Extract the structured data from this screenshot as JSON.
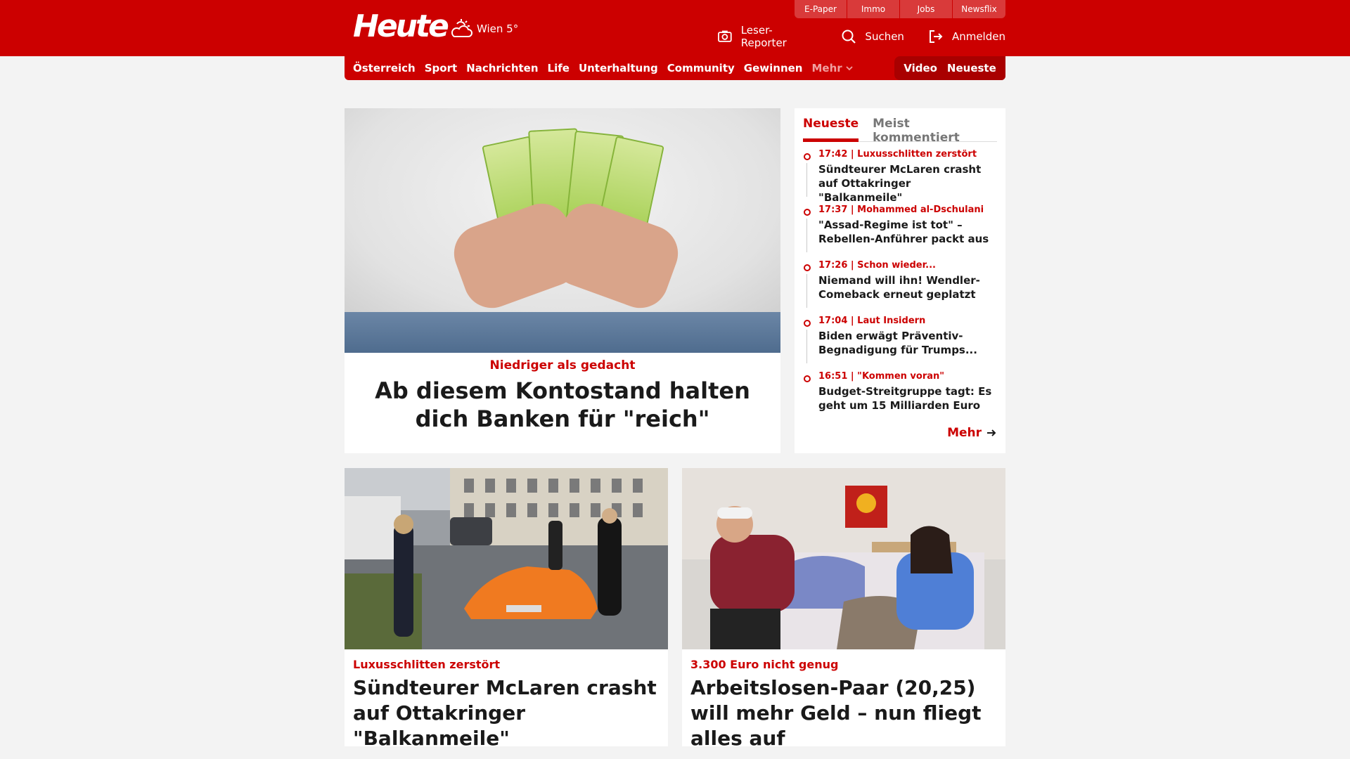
{
  "header": {
    "logo": "Heute",
    "weather": {
      "location": "Wien 5°",
      "icon": "partly-cloudy-icon"
    },
    "top_tabs": [
      "E-Paper",
      "Immo",
      "Jobs",
      "Newsflix"
    ],
    "actions": [
      {
        "label": "Leser-Reporter",
        "icon": "camera-icon"
      },
      {
        "label": "Suchen",
        "icon": "search-icon"
      },
      {
        "label": "Anmelden",
        "icon": "login-icon"
      }
    ]
  },
  "nav": {
    "items": [
      "Österreich",
      "Sport",
      "Nachrichten",
      "Life",
      "Unterhaltung",
      "Community",
      "Gewinnen"
    ],
    "more_label": "Mehr",
    "right_items": [
      "Video",
      "Neueste"
    ]
  },
  "hero": {
    "kicker": "Niedriger als gedacht",
    "title": "Ab diesem Kontostand halten dich Banken für \"reich\""
  },
  "side": {
    "tabs": [
      "Neueste",
      "Meist kommentiert"
    ],
    "items": [
      {
        "meta": "17:42 | Luxusschlitten zerstört",
        "title": "Sündteurer McLaren crasht auf Ottakringer \"Balkanmeile\""
      },
      {
        "meta": "17:37 | Mohammed al-Dschulani",
        "title": "\"Assad-Regime ist tot\" – Rebellen-Anführer packt aus"
      },
      {
        "meta": "17:26 | Schon wieder...",
        "title": "Niemand will ihn! Wendler-Comeback erneut geplatzt"
      },
      {
        "meta": "17:04 | Laut Insidern",
        "title": "Biden erwägt Präventiv-Begnadigung für Trumps..."
      },
      {
        "meta": "16:51 | \"Kommen voran\"",
        "title": "Budget-Streitgruppe tagt: Es geht um 15 Milliarden Euro"
      }
    ],
    "more_label": "Mehr"
  },
  "cards": [
    {
      "kicker": "Luxusschlitten zerstört",
      "title": "Sündteurer McLaren crasht auf Ottakringer \"Balkanmeile\""
    },
    {
      "kicker": "3.300 Euro nicht genug",
      "title": "Arbeitslosen-Paar (20,25) will mehr Geld – nun fliegt alles auf"
    }
  ],
  "colors": {
    "brand_red": "#cc0000",
    "dark_red": "#a90000",
    "background": "#f3f3f3"
  }
}
